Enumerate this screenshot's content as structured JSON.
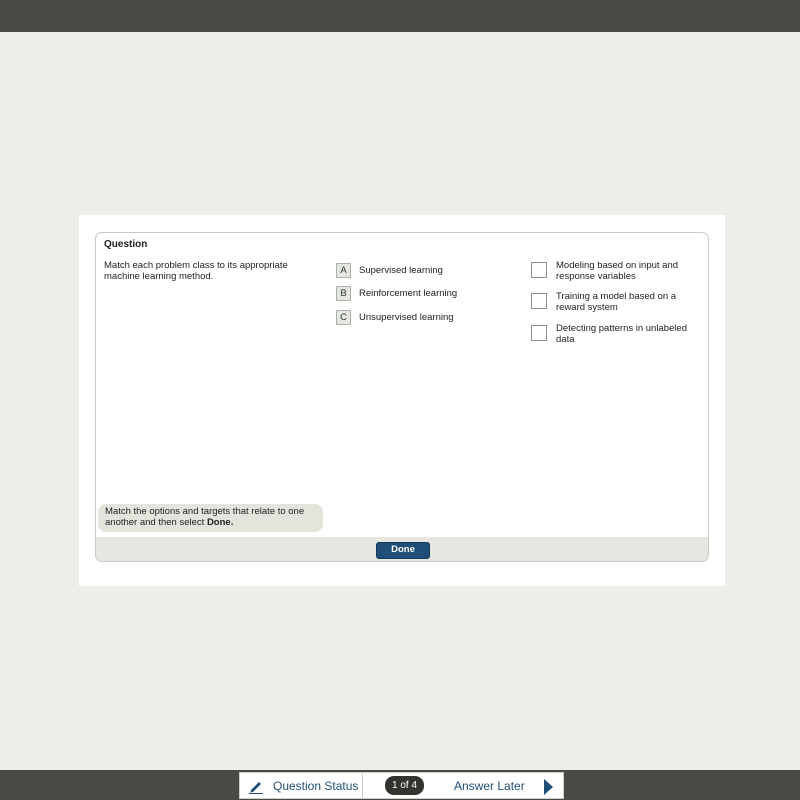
{
  "question": {
    "title": "Question",
    "prompt": "Match each problem class to its appropriate machine learning method.",
    "options": [
      {
        "letter": "A",
        "label": "Supervised learning"
      },
      {
        "letter": "B",
        "label": "Reinforcement learning"
      },
      {
        "letter": "C",
        "label": "Unsupervised learning"
      }
    ],
    "targets": [
      {
        "label": "Modeling based on input and response variables"
      },
      {
        "label": "Training a model based on a reward system"
      },
      {
        "label": "Detecting patterns in unlabeled data"
      }
    ],
    "hint_text": "Match the options and targets that relate to one another and then select",
    "hint_emphasis": "Done.",
    "done_label": "Done"
  },
  "nav": {
    "status_icon": "pencil-icon",
    "status_label": "Question Status",
    "counter": "1 of 4",
    "answer_later_label": "Answer Later",
    "next_icon": "next-arrow-icon"
  },
  "colors": {
    "accent": "#1f4e79",
    "chrome_bar": "#4a4a45",
    "page_background": "#ededea"
  }
}
